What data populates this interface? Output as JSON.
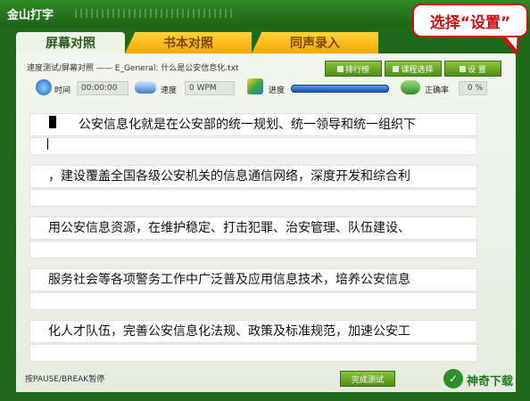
{
  "window": {
    "title": "金山打字"
  },
  "tabs": [
    {
      "label": "屏幕对照"
    },
    {
      "label": "书本对照"
    },
    {
      "label": "同声录入"
    }
  ],
  "info": {
    "line": "速度测试/屏幕对照 —— E_General: 什么是公安信息化.txt"
  },
  "buttons": {
    "ranking": "排行榜",
    "course": "课程选择",
    "settings": "设 置",
    "finish": "完成测试"
  },
  "stats": {
    "time_label": "时间",
    "time_value": "00:00:00",
    "speed_label": "速度",
    "speed_value": "0 WPM",
    "progress_label": "进度",
    "accuracy_label": "正确率",
    "accuracy_value": "0 %",
    "progress": 1.0
  },
  "rows": [
    {
      "text": "公安信息化就是在公安部的统一规划、统一领导和统一组织下"
    },
    {
      "text": "，建设覆盖全国各级公安机关的信息通信网络，深度开发和综合利"
    },
    {
      "text": "用公安信息资源，在维护稳定、打击犯罪、治安管理、队伍建设、"
    },
    {
      "text": "服务社会等各项警务工作中广泛普及应用信息技术，培养公安信息"
    },
    {
      "text": "化人才队伍，完善公安信息化法规、政策及标准规范，加速公安工"
    }
  ],
  "footer": {
    "hint": "按PAUSE/BREAK暂停"
  },
  "logo": {
    "text": "神奇下载"
  },
  "callout": {
    "text": "选择“设置”"
  },
  "colors": {
    "frame": "#1f6a1a",
    "accent": "#4e8f1a",
    "callout": "#d01010"
  }
}
